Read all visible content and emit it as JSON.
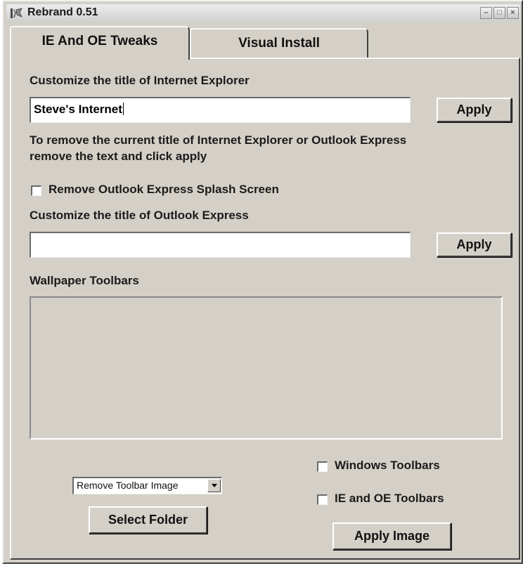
{
  "window": {
    "title": "Rebrand 0.51"
  },
  "title_buttons": {
    "minimize": "–",
    "maximize": "□",
    "close": "×"
  },
  "tabs": [
    {
      "label": "IE And OE Tweaks",
      "active": true
    },
    {
      "label": "Visual Install",
      "active": false
    }
  ],
  "ie_title": {
    "label": "Customize the title of Internet Explorer",
    "value": "Steve's Internet",
    "apply_label": "Apply"
  },
  "remove_note": {
    "line1": "To remove the current title of Internet Explorer or Outlook Express",
    "line2": "remove the text and click apply"
  },
  "splash_checkbox": {
    "label": "Remove Outlook Express Splash Screen",
    "checked": false
  },
  "oe_title": {
    "label": "Customize the title of Outlook Express",
    "value": "",
    "apply_label": "Apply"
  },
  "wallpaper": {
    "label": "Wallpaper Toolbars",
    "dropdown_value": "Remove Toolbar Image",
    "select_folder_label": "Select Folder",
    "windows_toolbars_label": "Windows Toolbars",
    "windows_toolbars_checked": false,
    "ie_oe_toolbars_label": "IE and OE Toolbars",
    "ie_oe_toolbars_checked": false,
    "apply_image_label": "Apply Image"
  },
  "icons": {
    "app": "rebrand-app-icon",
    "dropdown": "chevron-down-icon"
  }
}
